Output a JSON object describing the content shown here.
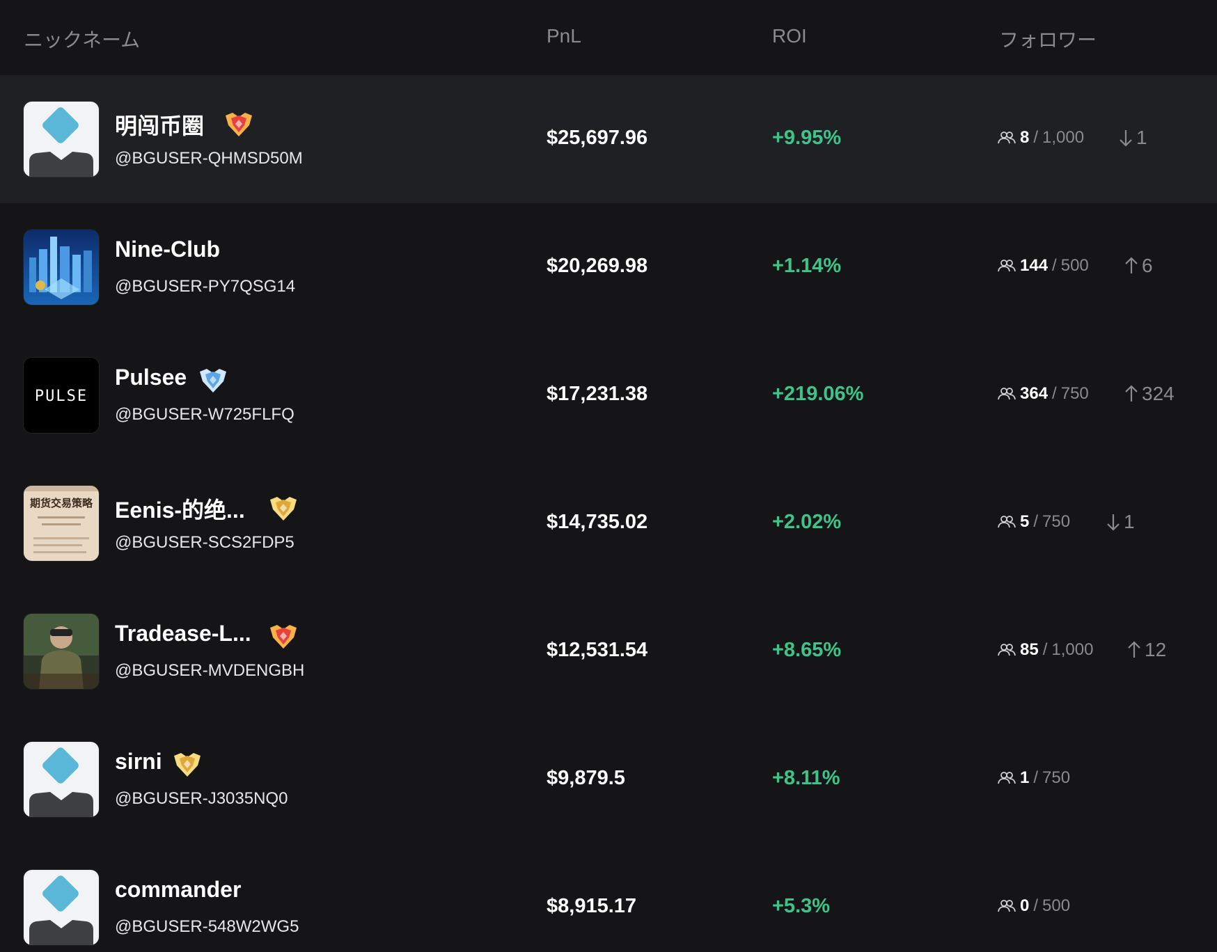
{
  "header": {
    "nickname": "ニックネーム",
    "pnl": "PnL",
    "roi": "ROI",
    "followers": "フォロワー"
  },
  "colors": {
    "background": "#151517",
    "highlight_row": "#1f2024",
    "positive": "#3ec48a",
    "muted": "#8a8b8f"
  },
  "rows": [
    {
      "name": "明闯币圈",
      "handle": "@BGUSER-QHMSD50M",
      "pnl": "$25,697.96",
      "roi": "+9.95%",
      "followers": "8",
      "sep": "/",
      "capacity": "1,000",
      "change": "1",
      "direction": "down",
      "badge": "red-gem-badge",
      "avatar": "default-avatar-icon"
    },
    {
      "name": "Nine-Club",
      "handle": "@BGUSER-PY7QSG14",
      "pnl": "$20,269.98",
      "roi": "+1.14%",
      "followers": "144",
      "sep": "/",
      "capacity": "500",
      "change": "6",
      "direction": "up",
      "badge": "",
      "avatar": "city-photo-avatar"
    },
    {
      "name": "Pulsee",
      "handle": "@BGUSER-W725FLFQ",
      "pnl": "$17,231.38",
      "roi": "+219.06%",
      "followers": "364",
      "sep": "/",
      "capacity": "750",
      "change": "324",
      "direction": "up",
      "badge": "blue-diamond-badge",
      "avatar": "pulse-logo-avatar",
      "avatar_text": "PULSE"
    },
    {
      "name": "Eenis-的绝...",
      "handle": "@BGUSER-SCS2FDP5",
      "pnl": "$14,735.02",
      "roi": "+2.02%",
      "followers": "5",
      "sep": "/",
      "capacity": "750",
      "change": "1",
      "direction": "down",
      "badge": "gold-badge",
      "avatar": "book-cover-avatar",
      "avatar_text": "期货交易策略"
    },
    {
      "name": "Tradease-L...",
      "handle": "@BGUSER-MVDENGBH",
      "pnl": "$12,531.54",
      "roi": "+8.65%",
      "followers": "85",
      "sep": "/",
      "capacity": "1,000",
      "change": "12",
      "direction": "up",
      "badge": "red-gem-badge",
      "avatar": "person-photo-avatar"
    },
    {
      "name": "sirni",
      "handle": "@BGUSER-J3035NQ0",
      "pnl": "$9,879.5",
      "roi": "+8.11%",
      "followers": "1",
      "sep": "/",
      "capacity": "750",
      "change": "",
      "direction": "",
      "badge": "gold-badge",
      "avatar": "default-avatar-icon"
    },
    {
      "name": "commander",
      "handle": "@BGUSER-548W2WG5",
      "pnl": "$8,915.17",
      "roi": "+5.3%",
      "followers": "0",
      "sep": "/",
      "capacity": "500",
      "change": "",
      "direction": "",
      "badge": "",
      "avatar": "default-avatar-icon"
    }
  ]
}
